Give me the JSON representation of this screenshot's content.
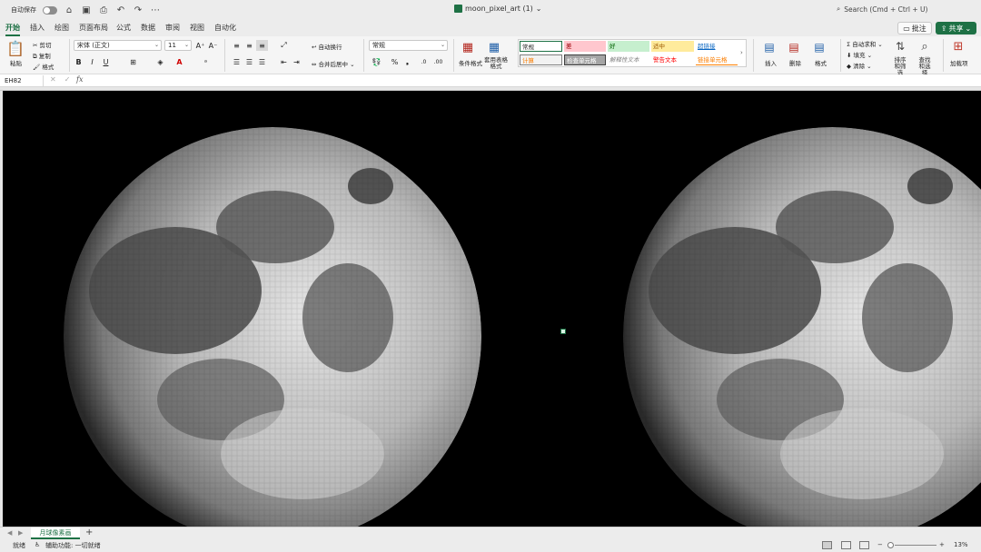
{
  "titlebar": {
    "autosave_label": "自动保存",
    "file_name": "moon_pixel_art (1)",
    "search_placeholder": "Search (Cmd + Ctrl + U)"
  },
  "tabs": [
    "开始",
    "插入",
    "绘图",
    "页面布局",
    "公式",
    "数据",
    "审阅",
    "视图",
    "自动化"
  ],
  "active_tab": "开始",
  "header_buttons": {
    "comment": "批注",
    "share": "共享"
  },
  "ribbon": {
    "paste": "粘贴",
    "cut": "剪切",
    "copy": "复制",
    "format_painter": "格式",
    "font_name": "宋体 (正文)",
    "font_size": "11",
    "bold": "B",
    "italic": "I",
    "underline": "U",
    "wrap_text": "自动换行",
    "merge_center": "合并后居中",
    "number_format": "常规",
    "conditional_format": "条件格式",
    "table_format": "套用表格格式",
    "styles": {
      "normal": "常规",
      "bad": "差",
      "good": "好",
      "neutral": "适中",
      "hyperlink": "超链接",
      "calculation": "计算",
      "check_cell": "检查单元格",
      "explanatory": "解释性文本",
      "warning": "警告文本",
      "linked_cell": "链接单元格"
    },
    "insert": "插入",
    "delete": "删除",
    "format": "格式",
    "autosum": "自动求和",
    "fill": "填充",
    "clear": "清除",
    "sort_filter": "排序和筛选",
    "find_select": "查找和选择",
    "addins": "加载项"
  },
  "formula_bar": {
    "name_box": "EH82",
    "fx": "fx",
    "content": ""
  },
  "sheet_tabs": [
    "月球像素画"
  ],
  "status": {
    "ready": "就绪",
    "accessibility": "辅助功能: 一切就绪",
    "zoom": "13%"
  },
  "colors": {
    "accent": "#1e7145",
    "sheet_bg": "#000000"
  }
}
